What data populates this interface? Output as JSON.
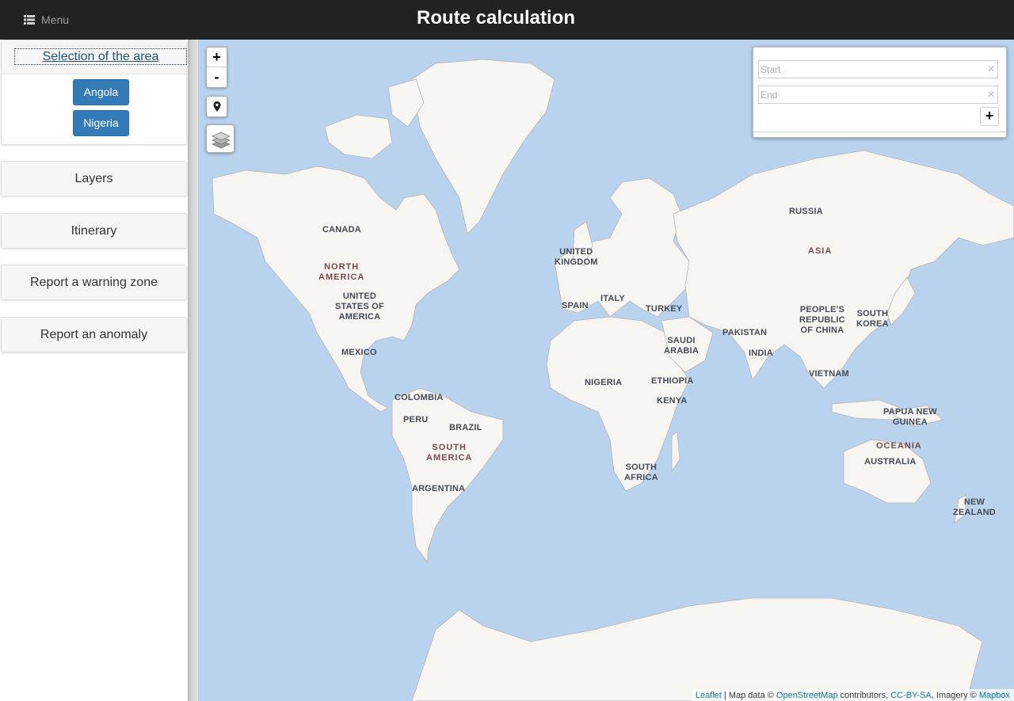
{
  "header": {
    "menu_label": "Menu",
    "title": "Route calculation",
    "menu_icon": "list-icon"
  },
  "sidebar": {
    "area_panel": {
      "heading": "Selection of the area",
      "countries": [
        "Angola",
        "Nigeria"
      ]
    },
    "panels": [
      "Layers",
      "Itinerary",
      "Report a warning zone",
      "Report an anomaly"
    ]
  },
  "map": {
    "zoom_in": "+",
    "zoom_out": "-",
    "locate_icon": "map-marker-icon",
    "layers_icon": "layers-icon",
    "routing": {
      "start_placeholder": "Start",
      "end_placeholder": "End",
      "clear_symbol": "×",
      "add_waypoint": "+"
    },
    "labels": {
      "canada": "CANADA",
      "north_america": "NORTH\nAMERICA",
      "usa": "UNITED\nSTATES OF\nAMERICA",
      "mexico": "MEXICO",
      "colombia": "COLOMBIA",
      "peru": "PERU",
      "brazil": "BRAZIL",
      "south_america": "SOUTH\nAMERICA",
      "argentina": "ARGENTINA",
      "uk": "UNITED\nKINGDOM",
      "spain": "SPAIN",
      "italy": "ITALY",
      "turkey": "TURKEY",
      "saudi": "SAUDI\nARABIA",
      "nigeria": "NIGERIA",
      "ethiopia": "ETHIOPIA",
      "kenya": "KENYA",
      "south_africa": "SOUTH\nAFRICA",
      "russia": "RUSSIA",
      "asia": "ASIA",
      "china": "PEOPLE'S\nREPUBLIC\nOF CHINA",
      "south_korea": "SOUTH\nKOREA",
      "pakistan": "PAKISTAN",
      "india": "INDIA",
      "vietnam": "VIETNAM",
      "png": "PAPUA NEW\nGUINEA",
      "oceania": "OCEANIA",
      "australia": "AUSTRALIA",
      "new_zealand": "NEW\nZEALAND"
    },
    "attribution": {
      "leaflet": "Leaflet",
      "sep1": " | Map data © ",
      "osm": "OpenStreetMap",
      "sep2": " contributors, ",
      "ccbysa": "CC-BY-SA",
      "sep3": ", Imagery © ",
      "mapbox": "Mapbox"
    }
  },
  "colors": {
    "topbar": "#222222",
    "primary_button": "#337ab7",
    "ocean": "#b9d3ee",
    "land": "#f7f5f2"
  }
}
